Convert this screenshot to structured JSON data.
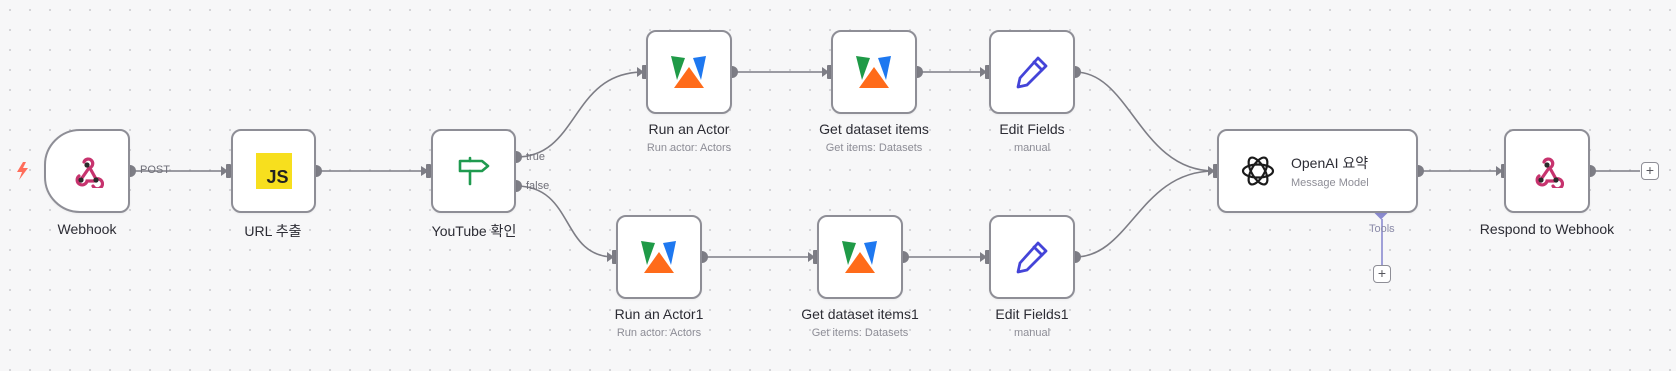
{
  "nodes": {
    "webhook": {
      "label": "Webhook"
    },
    "url_extract": {
      "label": "URL 추출",
      "icon_text": "JS"
    },
    "youtube_check": {
      "label": "YouTube 확인"
    },
    "run_actor": {
      "label": "Run an Actor",
      "subtitle": "Run actor: Actors"
    },
    "get_dataset": {
      "label": "Get dataset items",
      "subtitle": "Get items: Datasets"
    },
    "edit_fields": {
      "label": "Edit Fields",
      "subtitle": "manual"
    },
    "run_actor1": {
      "label": "Run an Actor1",
      "subtitle": "Run actor: Actors"
    },
    "get_dataset1": {
      "label": "Get dataset items1",
      "subtitle": "Get items: Datasets"
    },
    "edit_fields1": {
      "label": "Edit Fields1",
      "subtitle": "manual"
    },
    "openai": {
      "label": "OpenAI 요약",
      "subtitle": "Message Model",
      "tools_label": "Tools"
    },
    "respond": {
      "label": "Respond to Webhook"
    }
  },
  "edges": {
    "post": "POST",
    "true": "true",
    "false": "false"
  },
  "icons": {
    "trigger": "lightning-icon",
    "webhook": "webhook-icon",
    "code": "javascript-icon",
    "if": "signpost-icon",
    "apify": "apify-icon",
    "edit": "pencil-icon",
    "openai": "openai-icon",
    "add": "plus-icon"
  },
  "plus_symbol": "+",
  "colors": {
    "canvas": "#f7f7f8",
    "node_border": "#8e8e96",
    "edge": "#7d7d85",
    "trigger": "#ff6d5a",
    "webhook_pink": "#c7336e",
    "js_yellow": "#f7df1e",
    "if_green": "#1f9a4f",
    "apify_green": "#1f9a47",
    "apify_blue": "#1e78f0",
    "apify_orange": "#ff6b1a",
    "pencil_blue": "#4444d8",
    "tools_purple": "#8a8ad0"
  }
}
